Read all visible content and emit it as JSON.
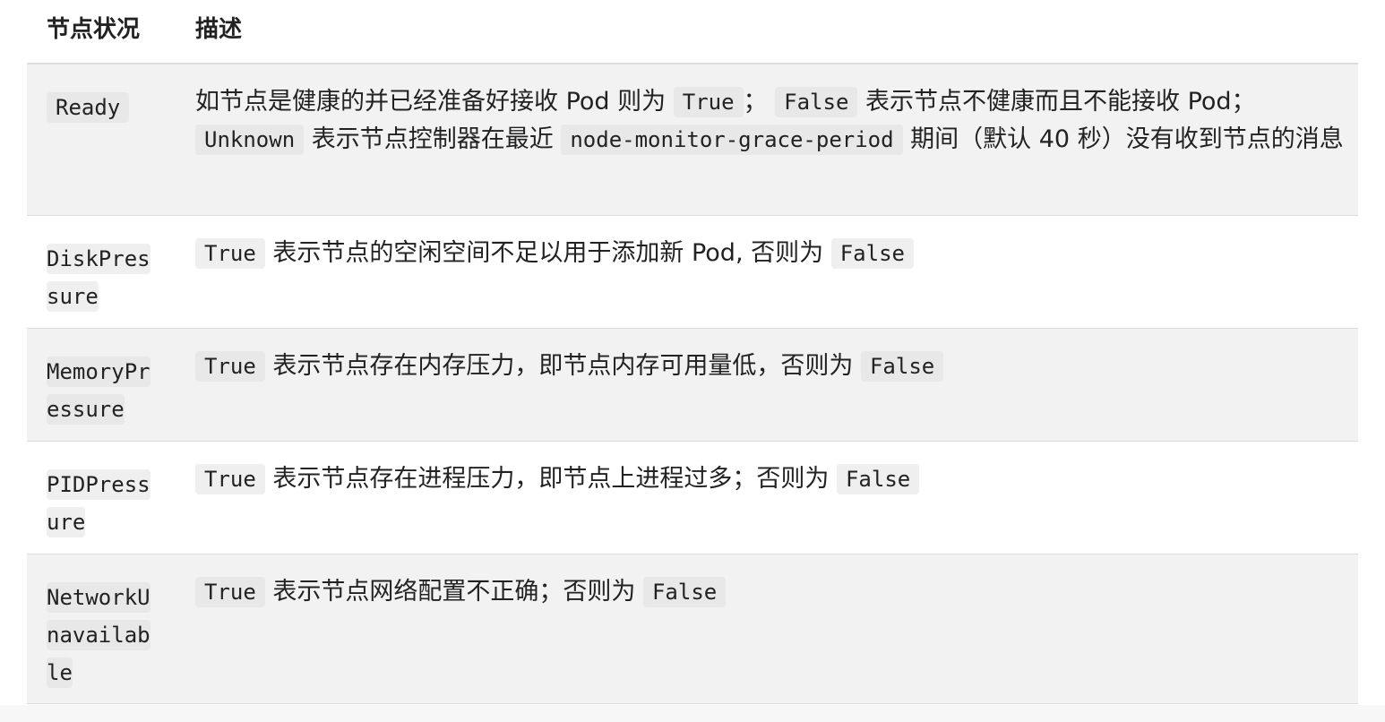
{
  "table": {
    "headers": {
      "status": "节点状况",
      "description": "描述"
    },
    "rows": [
      {
        "condition": "Ready",
        "desc": {
          "t1": "如节点是健康的并已经准备好接收 Pod 则为",
          "c1": "True",
          "t2": "；",
          "c2": "False",
          "t3": "表示节点不健康而且不能接收 Pod；",
          "c3": "Unknown",
          "t4": "表示节点控制器在最近",
          "c4": "node-monitor-grace-period",
          "t5": "期间（默认 40 秒）没有收到节点的消息"
        }
      },
      {
        "condition": "DiskPressure",
        "desc": {
          "c1": "True",
          "t1": "表示节点的空闲空间不足以用于添加新 Pod, 否则为",
          "c2": "False"
        }
      },
      {
        "condition": "MemoryPressure",
        "desc": {
          "c1": "True",
          "t1": "表示节点存在内存压力，即节点内存可用量低，否则为",
          "c2": "False"
        }
      },
      {
        "condition": "PIDPressure",
        "desc": {
          "c1": "True",
          "t1": "表示节点存在进程压力，即节点上进程过多；否则为",
          "c2": "False"
        }
      },
      {
        "condition": "NetworkUnavailable",
        "desc": {
          "c1": "True",
          "t1": "表示节点网络配置不正确；否则为",
          "c2": "False"
        }
      }
    ]
  }
}
